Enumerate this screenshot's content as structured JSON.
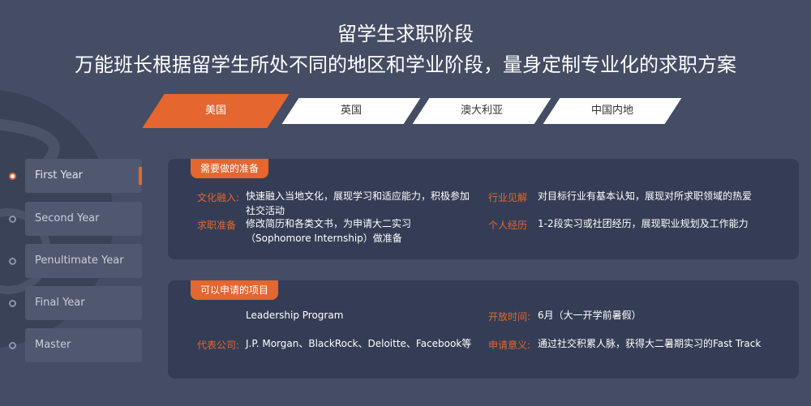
{
  "header": {
    "title": "留学生求职阶段",
    "subtitle": "万能班长根据留学生所处不同的地区和学业阶段，量身定制专业化的求职方案"
  },
  "tabs": [
    {
      "label": "美国",
      "active": true
    },
    {
      "label": "英国",
      "active": false
    },
    {
      "label": "澳大利亚",
      "active": false
    },
    {
      "label": "中国内地",
      "active": false
    }
  ],
  "years": [
    {
      "label": "First Year",
      "active": true
    },
    {
      "label": "Second Year",
      "active": false
    },
    {
      "label": "Penultimate Year",
      "active": false
    },
    {
      "label": "Final Year",
      "active": false
    },
    {
      "label": "Master",
      "active": false
    }
  ],
  "prep": {
    "badge": "需要做的准备",
    "culture_label": "文化融入:",
    "culture_value": "快速融入当地文化，展现学习和适应能力，积极参加社交活动",
    "job_label": "求职准备",
    "job_value": "修改简历和各类文书，为申请大二实习（Sophomore Internship）做准备",
    "industry_label": "行业见解",
    "industry_value": "对目标行业有基本认知，展现对所求职领域的热爱",
    "experience_label": "个人经历",
    "experience_value": "1-2段实习或社团经历，展现职业规划及工作能力"
  },
  "programs": {
    "badge": "可以申请的项目",
    "program_name": "Leadership Program",
    "company_label": "代表公司:",
    "company_value": "J.P. Morgan、BlackRock、Deloitte、Facebook等",
    "open_label": "开放时间:",
    "open_value": "6月（大一开学前暑假）",
    "meaning_label": "申请意义:",
    "meaning_value": "通过社交积累人脉，获得大二暑期实习的Fast Track"
  },
  "colors": {
    "background": "#444d64",
    "accent": "#e5662e",
    "card": "#343d55"
  }
}
